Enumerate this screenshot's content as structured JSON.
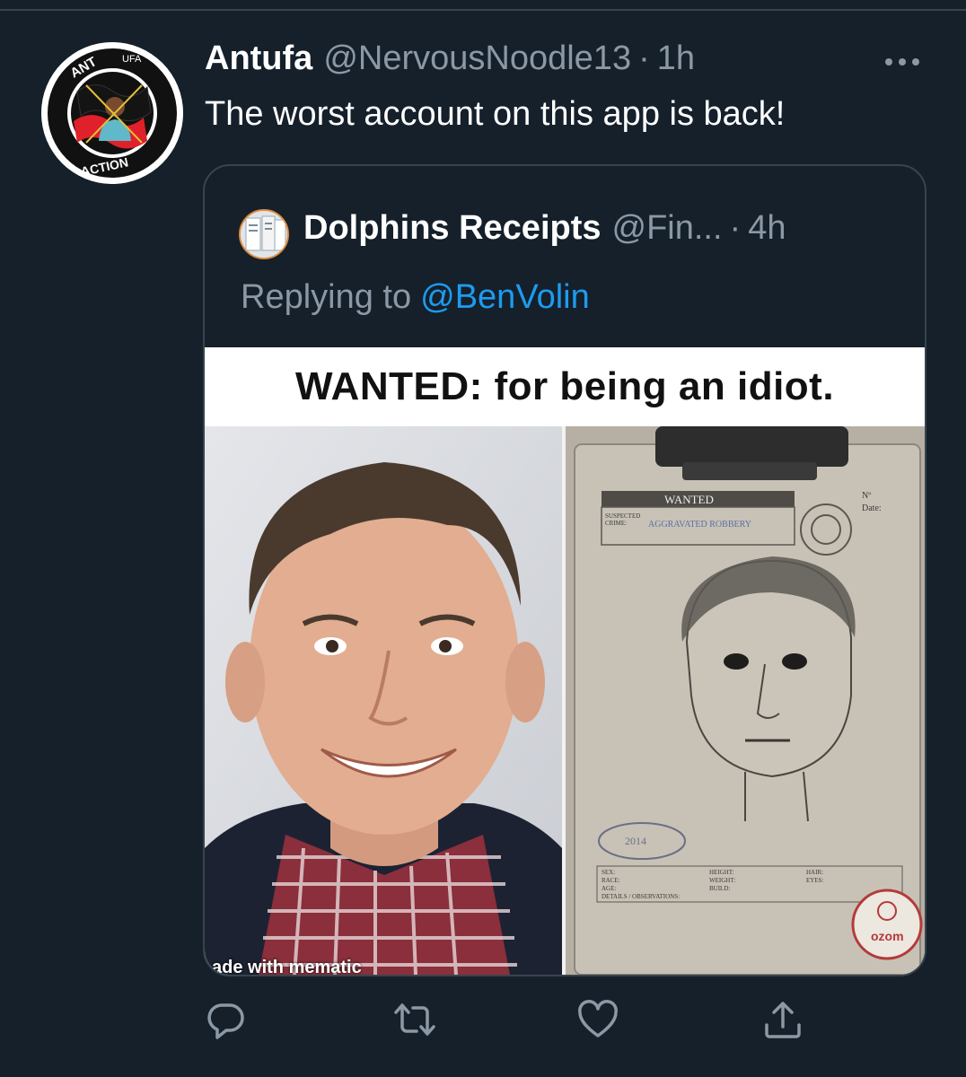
{
  "tweet": {
    "author_name": "Antufa",
    "author_handle": "@NervousNoodle13",
    "separator": "·",
    "time": "1h",
    "text": "The worst account on this app is back!",
    "avatar_text_top": "ANT",
    "avatar_text_ufa": "UFA",
    "avatar_text_bottom": "ACTION"
  },
  "quoted_tweet": {
    "author_name": "Dolphins Receipts",
    "author_handle": "@Fin...",
    "separator": "·",
    "time": "4h",
    "replying_prefix": "Replying to",
    "replying_mention": "@BenVolin",
    "image": {
      "caption": "WANTED: for being an idiot.",
      "watermark": "ade with mematic",
      "sketch_header": "WANTED",
      "sketch_crime_label": "SUSPECTED CRIME:",
      "sketch_crime_value": "AGGRAVATED ROBBERY",
      "sketch_no_label": "Nº",
      "sketch_date_label": "Date:",
      "sketch_stamp_text": "2014",
      "sketch_fields_left": [
        "SEX:",
        "RACE:",
        "AGE:",
        "DETAILS / OBSERVATIONS:"
      ],
      "sketch_fields_mid": [
        "HEIGHT:",
        "WEIGHT:",
        "BUILD:"
      ],
      "sketch_fields_right": [
        "HAIR:",
        "EYES:"
      ],
      "sketch_logo": "ozom"
    }
  },
  "actions": [
    {
      "name": "reply",
      "icon": "reply-icon"
    },
    {
      "name": "retweet",
      "icon": "retweet-icon"
    },
    {
      "name": "like",
      "icon": "heart-icon"
    },
    {
      "name": "share",
      "icon": "share-icon"
    }
  ],
  "colors": {
    "background": "#15202b",
    "border": "#38444d",
    "secondary_text": "#8b98a5",
    "link": "#1d9bf0"
  }
}
